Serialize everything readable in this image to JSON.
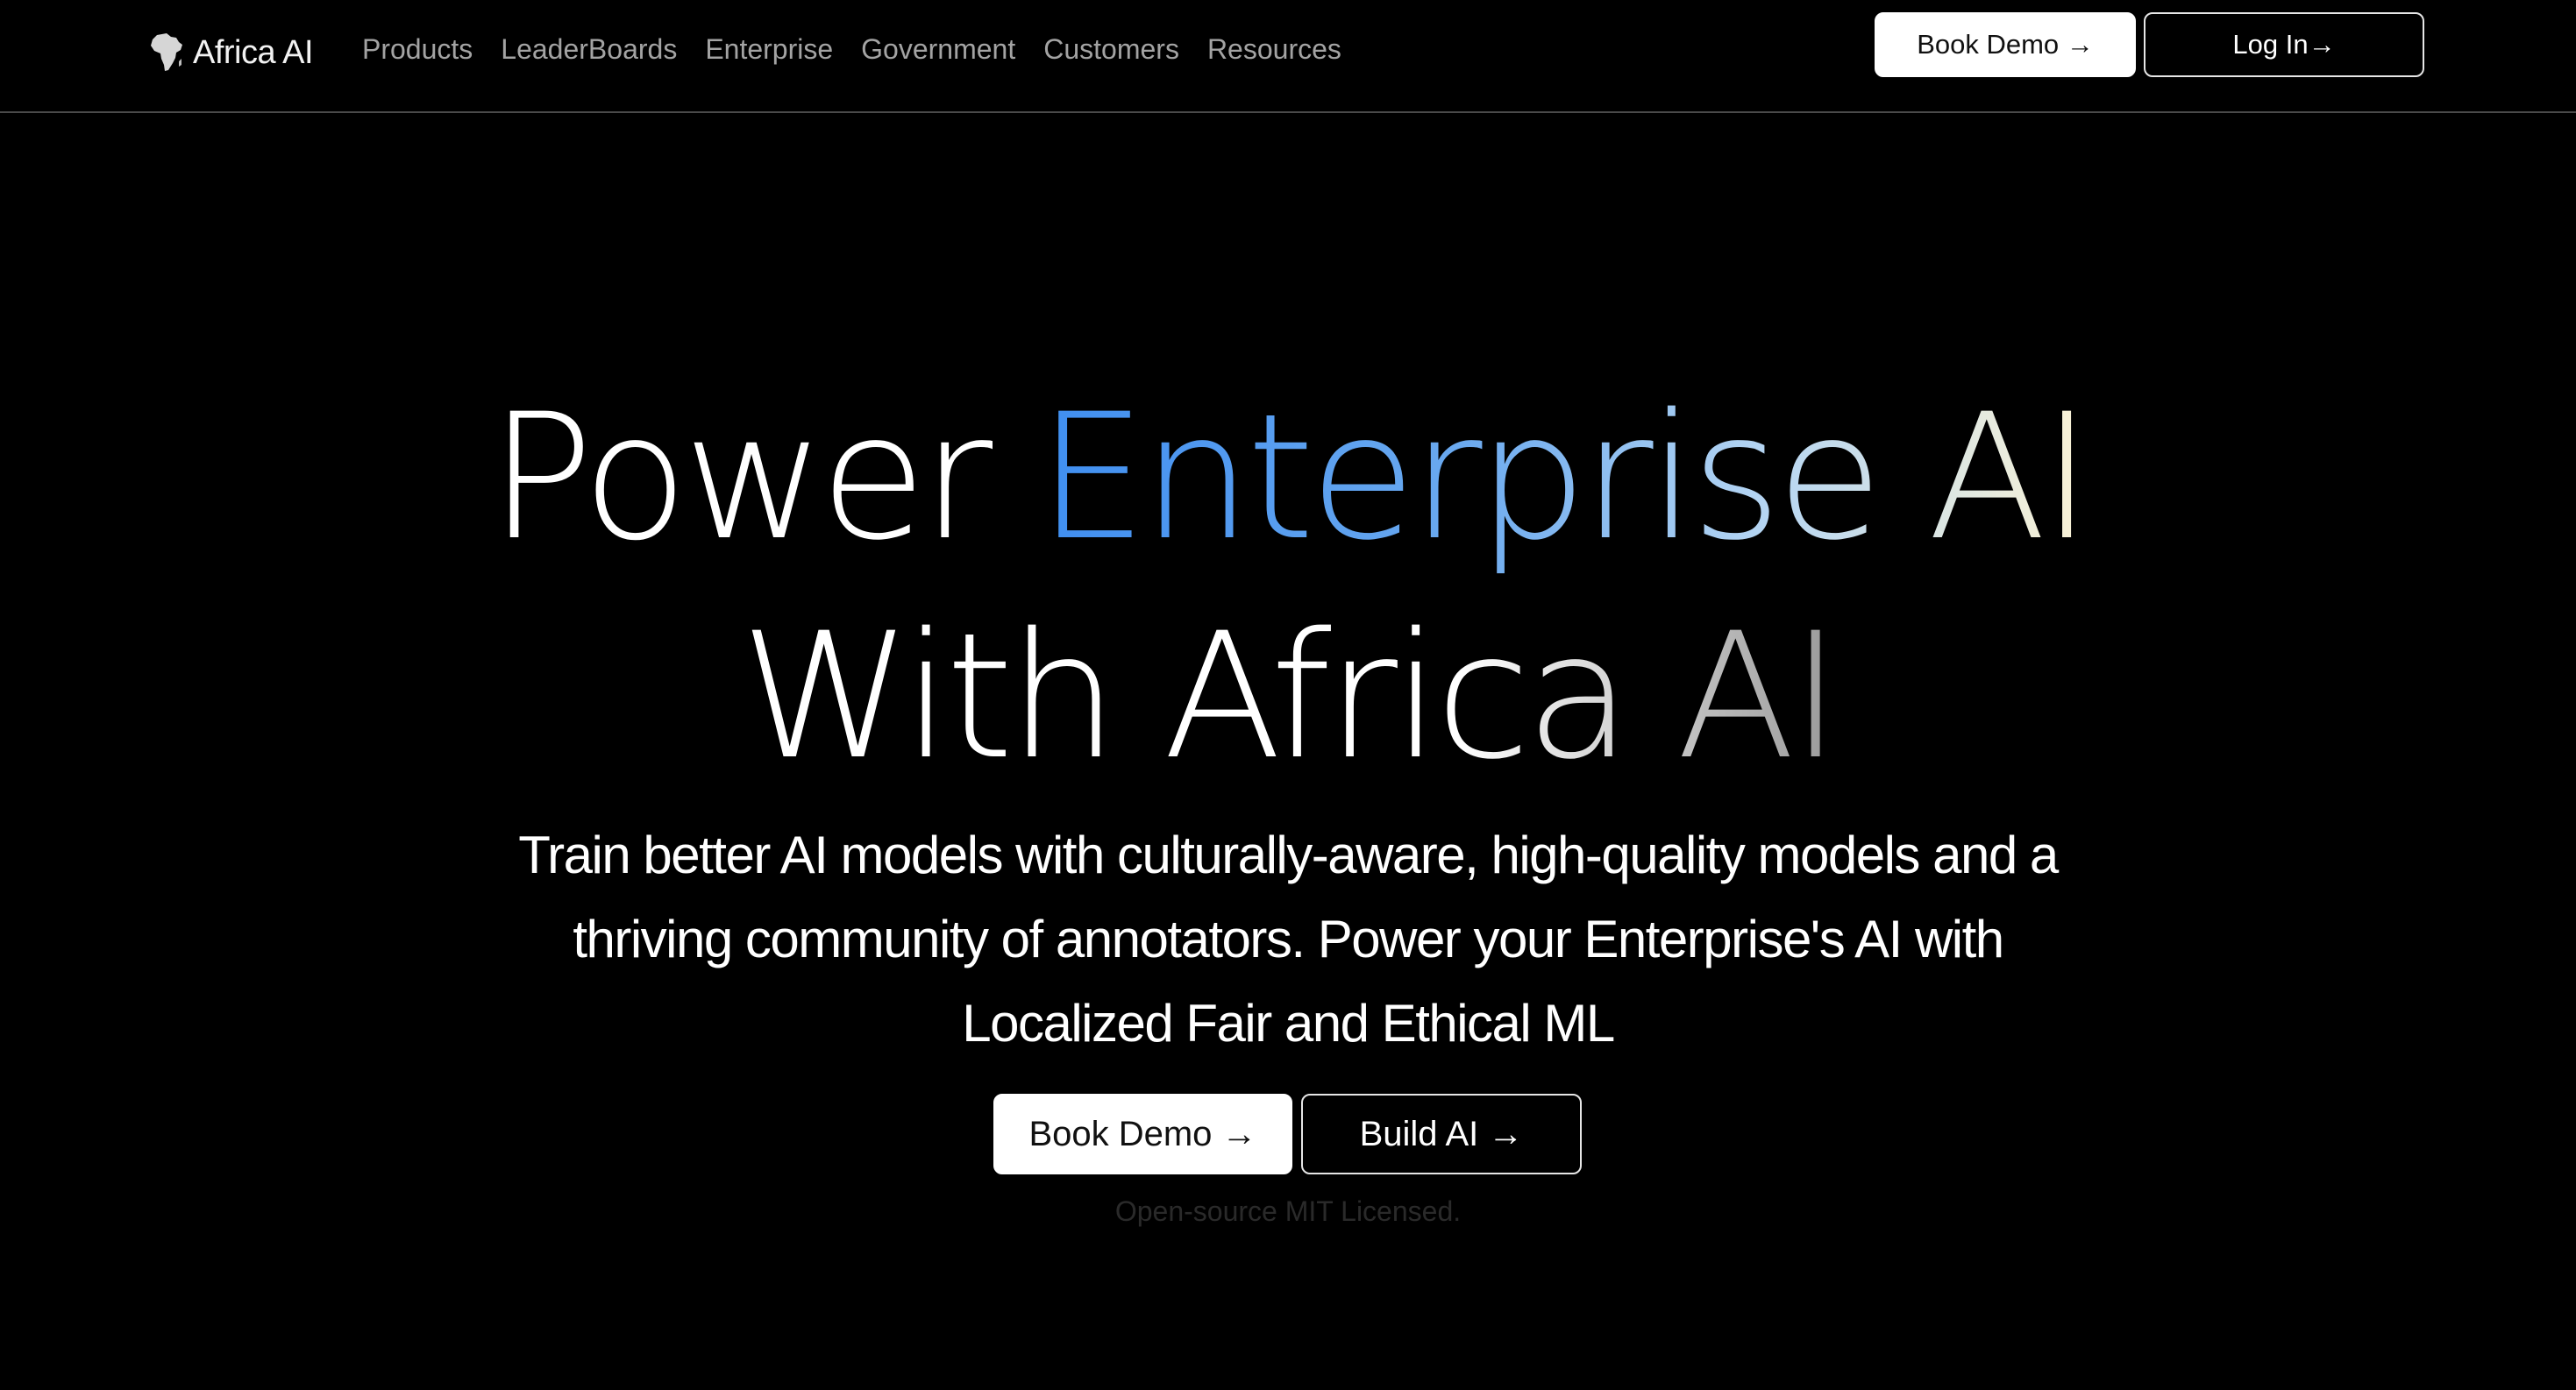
{
  "brand": {
    "name": "Africa AI",
    "icon": "africa-continent-icon"
  },
  "nav": {
    "links": [
      "Products",
      "LeaderBoards",
      "Enterprise",
      "Government",
      "Customers",
      "Resources"
    ],
    "book_demo": "Book Demo →",
    "log_in": "Log In→"
  },
  "hero": {
    "title_power": "Power",
    "title_highlight": "Enterprise AI",
    "title_line2": "With Africa AI",
    "subtitle": "Train better AI models with culturally-aware, high-quality models and a thriving community of annotators. Power your Enterprise's AI with Localized Fair and Ethical ML",
    "book_demo": "Book Demo →",
    "build_ai": "Build AI →",
    "license_note": "Open-source MIT Licensed."
  },
  "colors": {
    "background": "#000000",
    "gradient_start": "#3f8ef0",
    "gradient_end": "#fbf3d6",
    "nav_link": "#a3a3a3"
  }
}
